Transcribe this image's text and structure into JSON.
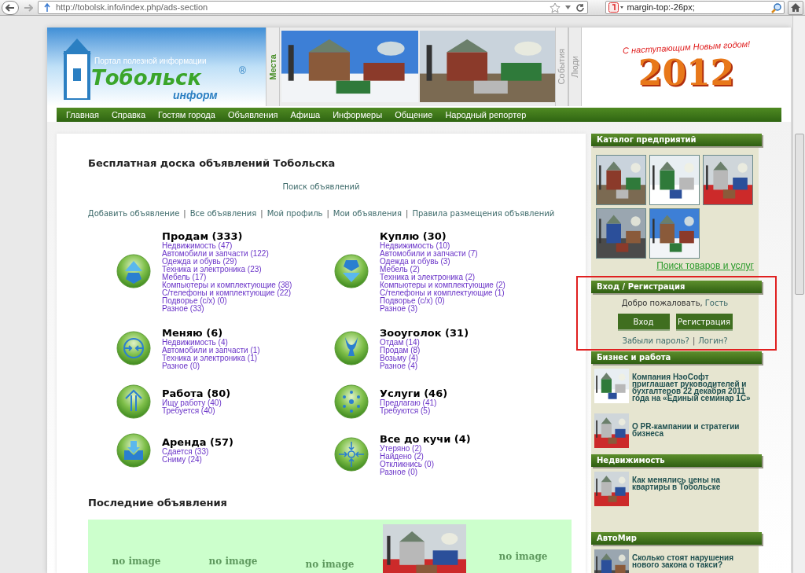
{
  "browser": {
    "url": "http://tobolsk.info/index.php/ads-section",
    "search_value": "margin-top:-26px;"
  },
  "header": {
    "tagline": "Портал полезной информации",
    "logo_title": "Тобольск",
    "registered": "®",
    "logo_subtitle": "информ",
    "tabs": [
      {
        "label": "Места",
        "selected": true
      },
      {
        "label": "События",
        "selected": false
      },
      {
        "label": "Люди",
        "selected": false
      }
    ],
    "greeting": "С наступающим Новым годом!",
    "year": "2012"
  },
  "nav": [
    "Главная",
    "Справка",
    "Гостям города",
    "Объявления",
    "Афиша",
    "Информеры",
    "Общение",
    "Народный репортер"
  ],
  "board": {
    "title": "Бесплатная доска объявлений Тобольска",
    "search_link": "Поиск объявлений",
    "separator": "|",
    "links": [
      "Добавить объявление",
      "Все объявления",
      "Мой профиль",
      "Мои объявления",
      "Правила размещения объявлений"
    ],
    "categories": [
      {
        "title": "Продам (333)",
        "items": [
          "Недвижимость (47)",
          "Автомобили и запчасти (122)",
          "Одежда и обувь (29)",
          "Техника и электроника (23)",
          "Мебель (17)",
          "Компьютеры и комплектующие (38)",
          "С/телефоны и комплектующие (22)",
          "Подворье (с/х) (0)",
          "Разное (33)"
        ]
      },
      {
        "title": "Куплю (30)",
        "items": [
          "Недвижимость (10)",
          "Автомобили и запчасти (7)",
          "Одежда и обувь (3)",
          "Мебель (2)",
          "Техника и электроника (2)",
          "Компьютеры и комплектующие (2)",
          "С/телефоны и комплектующие (1)",
          "Подворье (с/х) (0)",
          "Разное (3)"
        ]
      },
      {
        "title": "Меняю (6)",
        "items": [
          "Недвижимость (4)",
          "Автомобили и запчасти (1)",
          "Техника и электроника (1)",
          "Разное (0)"
        ]
      },
      {
        "title": "Зооуголок (31)",
        "items": [
          "Отдам (14)",
          "Продам (8)",
          "Возьму (4)",
          "Разное (4)"
        ]
      },
      {
        "title": "Работа (80)",
        "items": [
          "Ищу работу (40)",
          "Требуется (40)"
        ]
      },
      {
        "title": "Услуги (46)",
        "items": [
          "Предлагаю (41)",
          "Требуются (5)"
        ]
      },
      {
        "title": "Аренда (57)",
        "items": [
          "Сдается (33)",
          "Сниму (24)"
        ]
      },
      {
        "title": "Все до кучи (4)",
        "items": [
          "Утеряно (2)",
          "Найдено (2)",
          "Откликнись (0)",
          "Разное (0)"
        ]
      }
    ],
    "latest_title": "Последние объявления",
    "latest": [
      {
        "kind": "no_image",
        "label": "no image"
      },
      {
        "kind": "no_image",
        "label": "no image"
      },
      {
        "kind": "no_image",
        "label": "no image"
      },
      {
        "kind": "picture"
      },
      {
        "kind": "no_image",
        "label": "no image"
      }
    ]
  },
  "sidebar": {
    "catalog": {
      "title": "Каталог предприятий",
      "logos": [
        {
          "kind": "picture"
        },
        {
          "kind": "picture"
        },
        {
          "kind": "picture"
        },
        {
          "kind": "picture"
        },
        {
          "kind": "picture"
        }
      ],
      "search_link": "Поиск товаров и услуг"
    },
    "login": {
      "title": "Вход / Регистрация",
      "welcome": "Добро пожаловать,",
      "guest": "Гость",
      "buttons": [
        "Вход",
        "Регистрация"
      ],
      "forgot": "Забыли пароль?",
      "separator": "|",
      "login_link": "Логин?"
    },
    "sections": [
      {
        "title": "Бизнес и работа",
        "articles": [
          "Компания НэоСофт приглашает руководителей и бухгалтеров 22 декабря 2011 года на «Единый семинар 1С»",
          "О PR-кампании и стратегии бизнеса"
        ]
      },
      {
        "title": "Недвижимость",
        "articles": [
          "Как менялись цены на квартиры в Тобольске"
        ]
      },
      {
        "title": "АвтоМир",
        "articles": [
          "Сколько стоят нарушения нового закона о такси?"
        ]
      }
    ]
  }
}
